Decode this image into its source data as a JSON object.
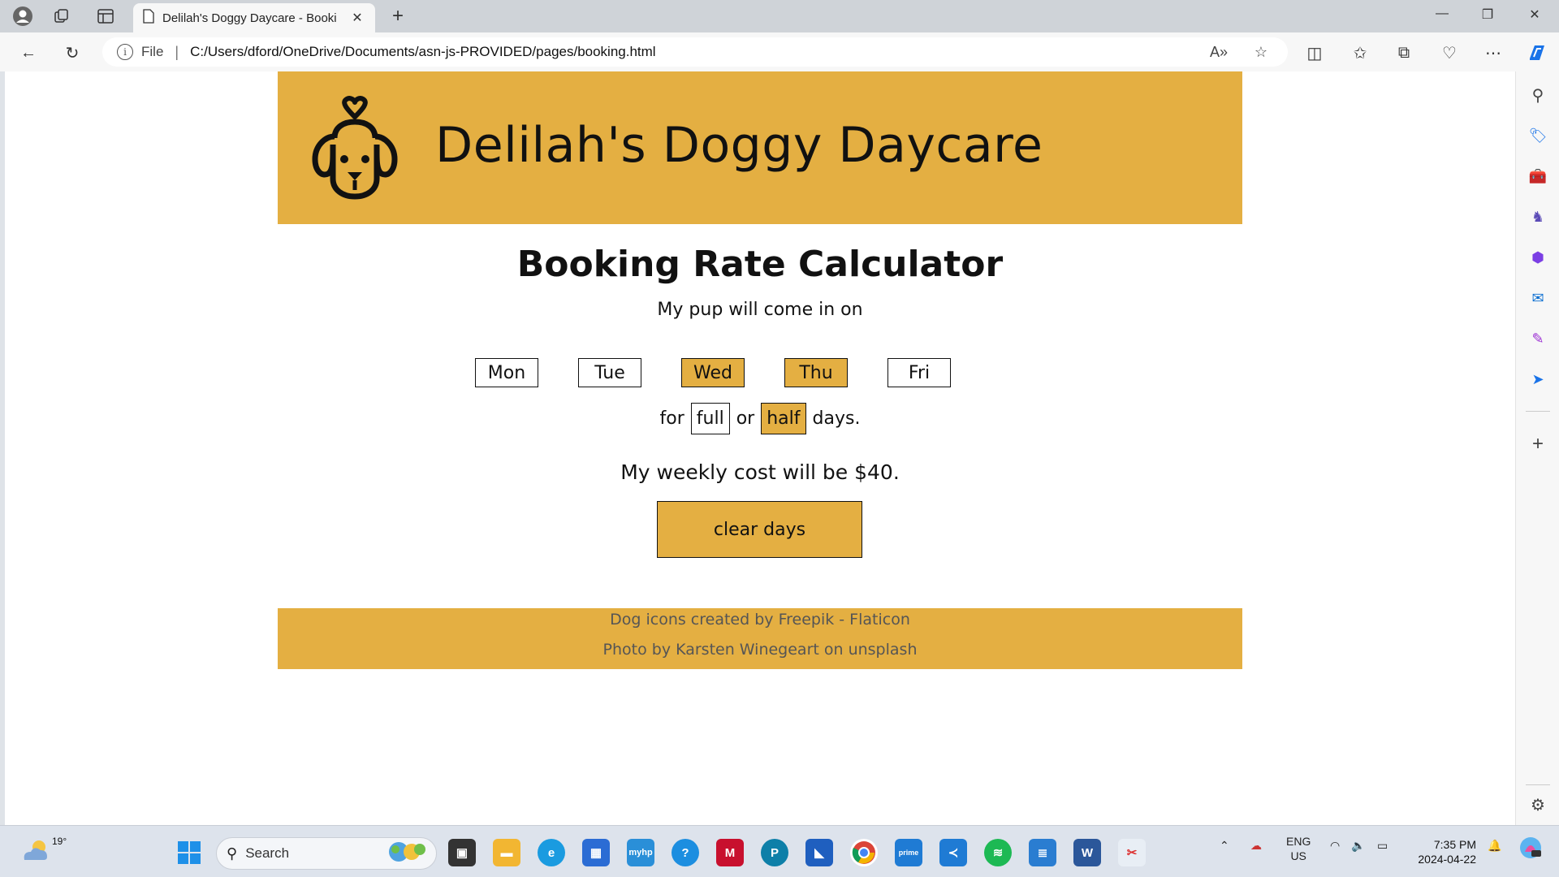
{
  "browser": {
    "tab_title": "Delilah's Doggy Daycare - Booki",
    "address_scheme": "File",
    "address_url": "C:/Users/dford/OneDrive/Documents/asn-js-PROVIDED/pages/booking.html"
  },
  "site": {
    "title": "Delilah's Doggy Daycare"
  },
  "calculator": {
    "heading": "Booking Rate Calculator",
    "intro": "My pup will come in on",
    "days": [
      {
        "label": "Mon",
        "selected": false
      },
      {
        "label": "Tue",
        "selected": false
      },
      {
        "label": "Wed",
        "selected": true
      },
      {
        "label": "Thu",
        "selected": true
      },
      {
        "label": "Fri",
        "selected": false
      }
    ],
    "for_text": "for",
    "full_label": "full",
    "or_text": "or",
    "half_label": "half",
    "days_text": "days.",
    "cost_prefix": "My weekly cost will be ",
    "cost_value": "$40",
    "cost_suffix": ".",
    "clear_label": "clear days"
  },
  "footer": {
    "credit1": "Dog icons created by Freepik - Flaticon",
    "credit2": "Photo by Karsten Winegeart on unsplash"
  },
  "taskbar": {
    "weather_temp": "19°",
    "search_placeholder": "Search",
    "lang_line1": "ENG",
    "lang_line2": "US",
    "time": "7:35 PM",
    "date": "2024-04-22"
  },
  "colors": {
    "accent": "#e4af42",
    "edge_blue": "#1a73e8"
  }
}
